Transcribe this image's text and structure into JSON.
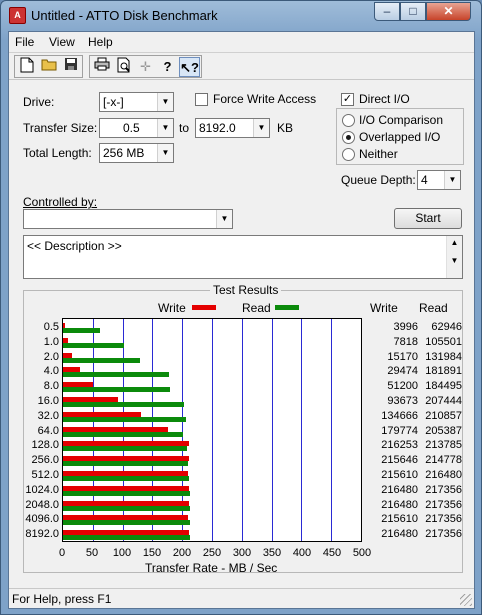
{
  "window": {
    "title": "Untitled - ATTO Disk Benchmark",
    "min": "–",
    "max": "□",
    "close": "✕"
  },
  "menu": [
    "File",
    "View",
    "Help"
  ],
  "toolbar": [
    "new-icon",
    "open-icon",
    "save-icon",
    "print-icon",
    "print-preview-icon",
    "move-icon",
    "help-icon",
    "context-help-icon"
  ],
  "settings": {
    "drive_label": "Drive:",
    "drive_value": "[-x-]",
    "transfer_size_label": "Transfer Size:",
    "transfer_from": "0.5",
    "to_label": "to",
    "transfer_to": "8192.0",
    "kb_label": "KB",
    "total_length_label": "Total Length:",
    "total_length_value": "256 MB",
    "force_write_label": "Force Write Access",
    "direct_io_label": "Direct I/O",
    "io_comparison_label": "I/O Comparison",
    "overlapped_io_label": "Overlapped I/O",
    "neither_label": "Neither",
    "queue_depth_label": "Queue Depth:",
    "queue_depth_value": "4",
    "controlled_by_label": "Controlled by:",
    "controlled_by_value": "",
    "start_label": "Start",
    "description": "<< Description >>"
  },
  "chart_data": {
    "type": "bar",
    "title": "Test Results",
    "xlabel": "Transfer Rate - MB / Sec",
    "xlim": [
      0,
      500
    ],
    "xticks": [
      "0",
      "50",
      "100",
      "150",
      "200",
      "250",
      "300",
      "350",
      "400",
      "450",
      "500"
    ],
    "legend": [
      "Write",
      "Read"
    ],
    "column_headers": [
      "Write",
      "Read"
    ],
    "categories": [
      "0.5",
      "1.0",
      "2.0",
      "4.0",
      "8.0",
      "16.0",
      "32.0",
      "64.0",
      "128.0",
      "256.0",
      "512.0",
      "1024.0",
      "2048.0",
      "4096.0",
      "8192.0"
    ],
    "series": [
      {
        "name": "Write",
        "color": "#e40000",
        "values_kb": [
          3996,
          7818,
          15170,
          29474,
          51200,
          93673,
          134666,
          179774,
          216253,
          215646,
          215610,
          216480,
          216480,
          215610,
          216480
        ]
      },
      {
        "name": "Read",
        "color": "#0b8a0b",
        "values_kb": [
          62946,
          105501,
          131984,
          181891,
          184495,
          207444,
          210857,
          205387,
          213785,
          214778,
          216480,
          217356,
          217356,
          217356,
          217356
        ]
      }
    ]
  },
  "status": {
    "text": "For Help, press F1"
  }
}
